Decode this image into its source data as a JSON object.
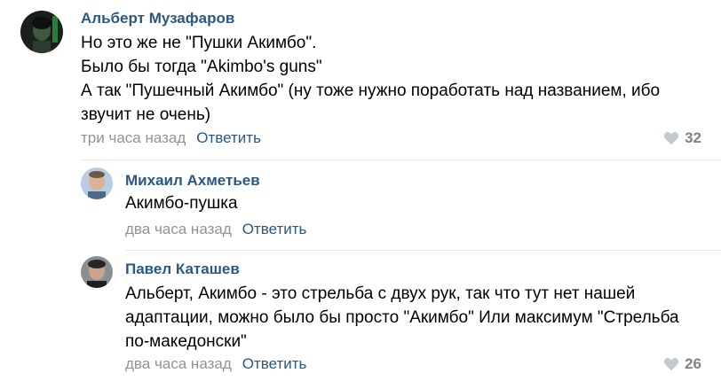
{
  "comments": [
    {
      "author": "Альберт Музафаров",
      "lines": [
        "Но это же не \"Пушки Акимбо\".",
        "Было бы тогда \"Akimbo's guns\"",
        "А так \"Пушечный Акимбо\" (ну тоже нужно поработать над названием, ибо",
        "звучит не очень)"
      ],
      "time": "три часа назад",
      "reply_label": "Ответить",
      "likes": "32"
    },
    {
      "author": "Михаил Ахметьев",
      "lines": [
        "Акимбо-пушка"
      ],
      "time": "два часа назад",
      "reply_label": "Ответить"
    },
    {
      "author": "Павел Каташев",
      "lines": [
        "Альберт, Акимбо - это стрельба с двух рук, так что тут нет нашей",
        "адаптации, можно было бы просто \"Акимбо\" Или максимум \"Стрельба",
        "по-македонски\""
      ],
      "time": "два часа назад",
      "reply_label": "Ответить",
      "likes": "26"
    }
  ],
  "colors": {
    "link": "#2a5885",
    "muted": "#939393",
    "likes": "#828282",
    "divider": "#e7e8ec"
  }
}
